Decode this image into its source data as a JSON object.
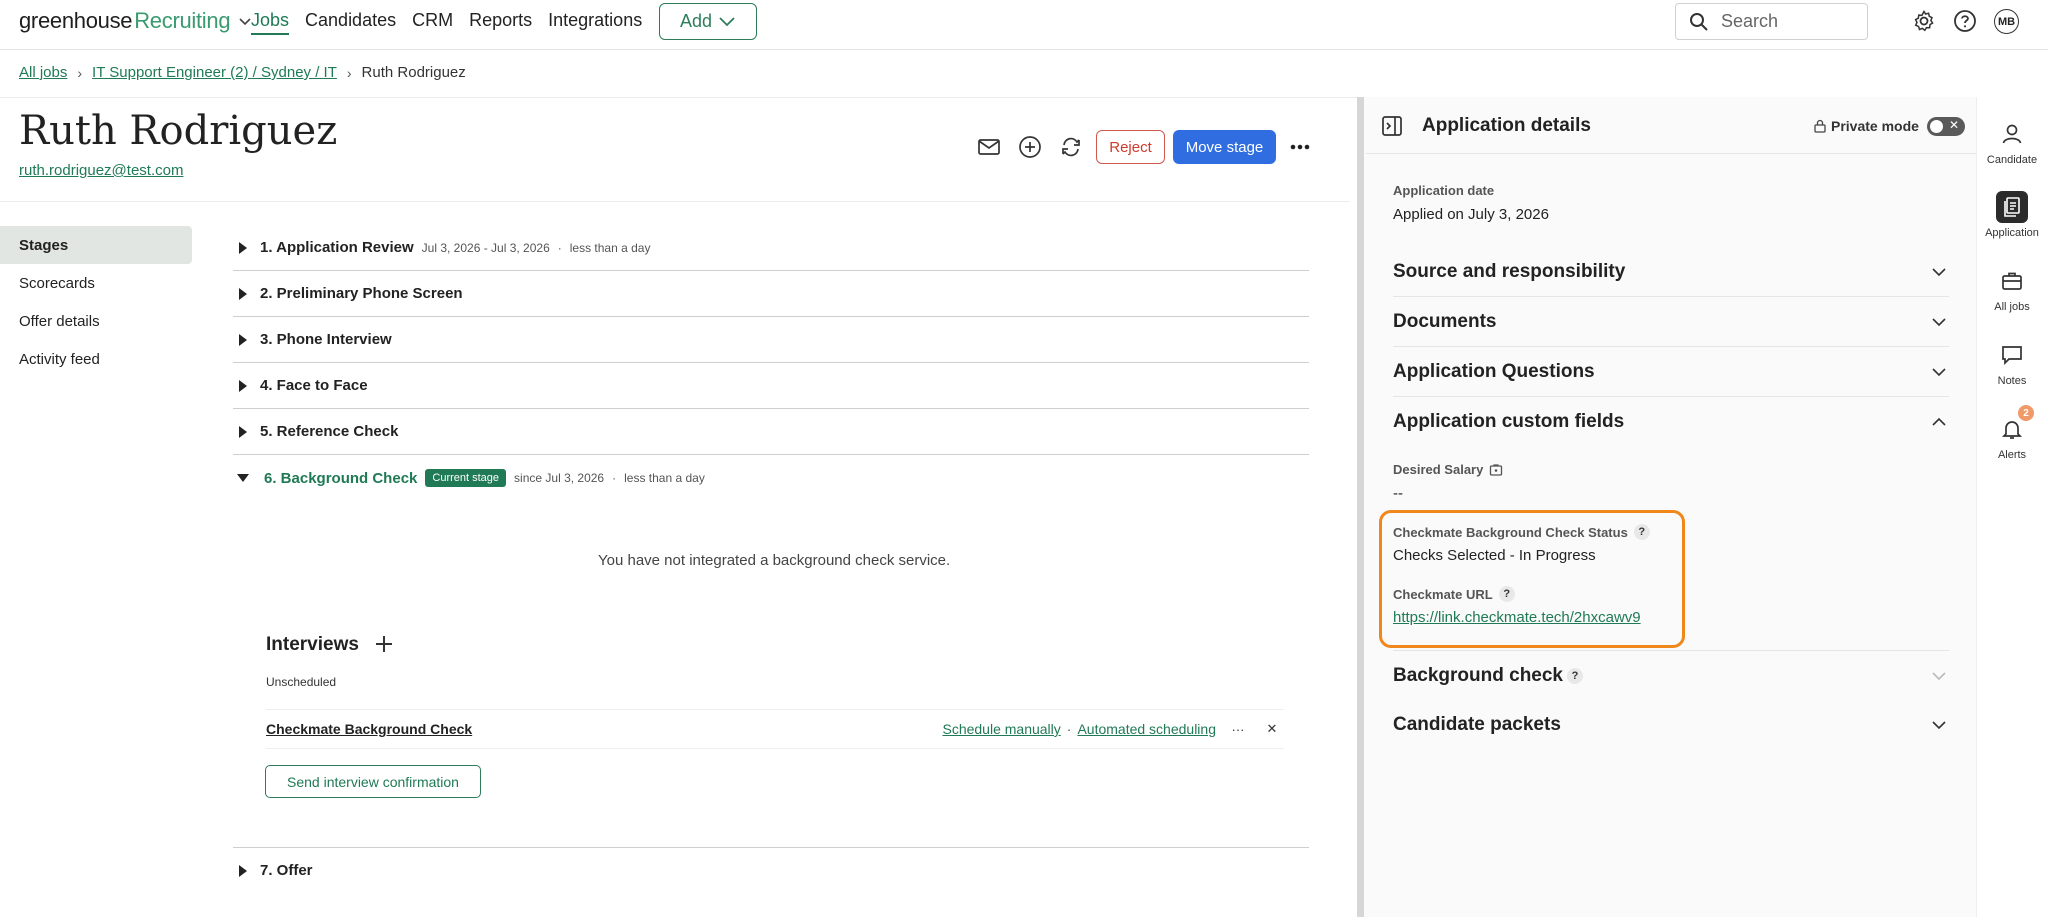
{
  "topnav": {
    "logo_main": "greenhouse",
    "logo_product": "Recruiting",
    "links": [
      "Jobs",
      "Candidates",
      "CRM",
      "Reports",
      "Integrations"
    ],
    "active_link": "Jobs",
    "add_label": "Add",
    "search_placeholder": "Search",
    "avatar_initials": "MB"
  },
  "breadcrumb": {
    "all_jobs": "All jobs",
    "job": "IT Support Engineer (2) / Sydney / IT",
    "current": "Ruth Rodriguez"
  },
  "candidate": {
    "name": "Ruth Rodriguez",
    "email": "ruth.rodriguez@test.com"
  },
  "actions": {
    "reject": "Reject",
    "move_stage": "Move stage"
  },
  "left_menu": [
    "Stages",
    "Scorecards",
    "Offer details",
    "Activity feed"
  ],
  "stages": [
    {
      "name": "1. Application Review",
      "dates": "Jul 3, 2026 - Jul 3, 2026",
      "duration": "less than a day"
    },
    {
      "name": "2. Preliminary Phone Screen"
    },
    {
      "name": "3. Phone Interview"
    },
    {
      "name": "4. Face to Face"
    },
    {
      "name": "5. Reference Check"
    },
    {
      "name": "6. Background Check",
      "badge": "Current stage",
      "since": "since Jul 3, 2026",
      "duration": "less than a day"
    },
    {
      "name": "7. Offer"
    }
  ],
  "background_check": {
    "message": "You have not integrated a background check service.",
    "interviews_title": "Interviews",
    "unscheduled_label": "Unscheduled",
    "interview_name": "Checkmate Background Check",
    "schedule_manually": "Schedule manually",
    "automated_scheduling": "Automated scheduling",
    "send_confirmation": "Send interview confirmation"
  },
  "details_panel": {
    "title": "Application details",
    "private_mode": "Private mode",
    "application_date_label": "Application date",
    "application_date_value": "Applied on July 3, 2026",
    "sections": {
      "source": "Source and responsibility",
      "documents": "Documents",
      "questions": "Application Questions",
      "custom_fields": "Application custom fields",
      "background_check": "Background check",
      "packets": "Candidate packets"
    },
    "desired_salary_label": "Desired Salary",
    "desired_salary_value": "--",
    "checkmate_status_label": "Checkmate Background Check Status",
    "checkmate_status_value": "Checks Selected - In Progress",
    "checkmate_url_label": "Checkmate URL",
    "checkmate_url_value": "https://link.checkmate.tech/2hxcawv9",
    "help_mark": "?"
  },
  "rail": {
    "candidate": "Candidate",
    "application": "Application",
    "all_jobs": "All jobs",
    "notes": "Notes",
    "alerts": "Alerts",
    "alerts_count": "2"
  },
  "colors": {
    "brand_green": "#1f7a55",
    "primary_blue": "#2f6de0",
    "reject_red": "#cf3a2e",
    "highlight_orange": "#f0871a"
  }
}
